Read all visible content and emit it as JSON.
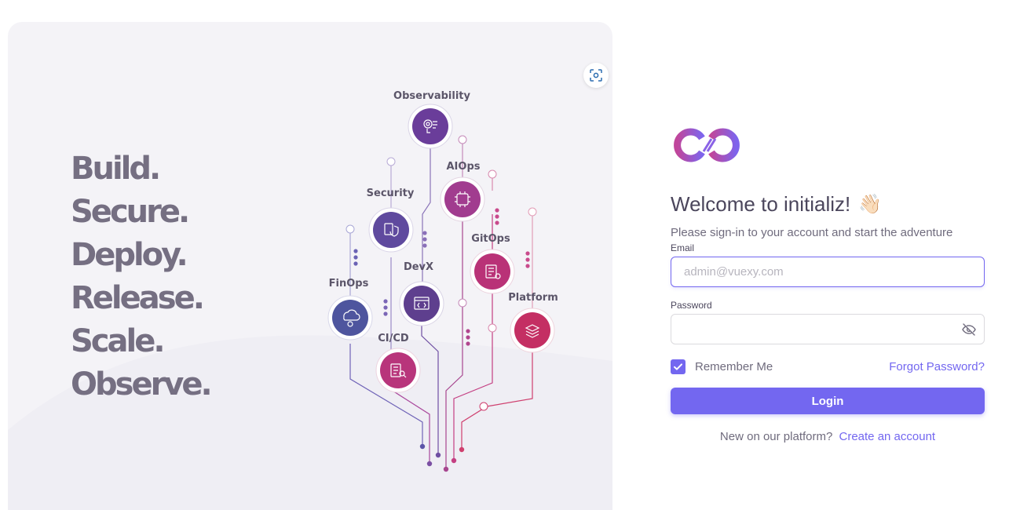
{
  "hero": {
    "tagline": [
      "Build.",
      "Secure.",
      "Deploy.",
      "Release.",
      "Scale.",
      "Observe."
    ],
    "nodes": [
      {
        "label": "Observability",
        "icon": "observability-icon",
        "color": "#6a3d9a"
      },
      {
        "label": "AIOps",
        "icon": "aiops-icon",
        "color": "#a13c8f"
      },
      {
        "label": "Security",
        "icon": "security-icon",
        "color": "#5f4a9e"
      },
      {
        "label": "GitOps",
        "icon": "gitops-icon",
        "color": "#b93277"
      },
      {
        "label": "DevX",
        "icon": "devx-icon",
        "color": "#5e3f8e"
      },
      {
        "label": "FinOps",
        "icon": "finops-icon",
        "color": "#4e559e"
      },
      {
        "label": "Platform",
        "icon": "platform-icon",
        "color": "#c42f63"
      },
      {
        "label": "CI/CD",
        "icon": "cicd-icon",
        "color": "#b8357b"
      }
    ]
  },
  "login": {
    "brand_colors": {
      "start": "#c0469b",
      "end": "#7367f0"
    },
    "welcome": "Welcome to initializ!",
    "wave_emoji": "👋🏻",
    "subtitle": "Please sign-in to your account and start the adventure",
    "email_label": "Email",
    "email_placeholder": "admin@vuexy.com",
    "email_value": "",
    "password_label": "Password",
    "password_value": "",
    "remember_label": "Remember Me",
    "remember_checked": true,
    "forgot_label": "Forgot Password?",
    "login_label": "Login",
    "signup_prompt": "New on our platform?",
    "signup_link": "Create an account"
  },
  "theme": {
    "accent": "#7367f0",
    "text": "#4b465c",
    "muted": "#6f6b7d"
  }
}
